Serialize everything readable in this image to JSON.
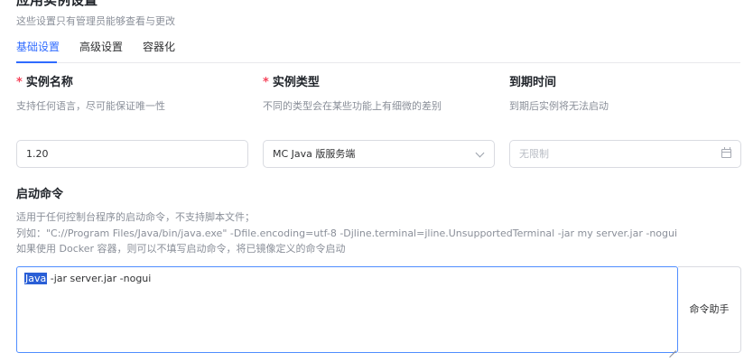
{
  "section": {
    "title": "应用实例设置",
    "description": "这些设置只有管理员能够查看与更改"
  },
  "tabs": [
    {
      "label": "基础设置",
      "active": true
    },
    {
      "label": "高级设置",
      "active": false
    },
    {
      "label": "容器化",
      "active": false
    }
  ],
  "fields": {
    "name": {
      "required_mark": "*",
      "title": "实例名称",
      "description": "支持任何语言，尽可能保证唯一性",
      "value": "1.20"
    },
    "type": {
      "required_mark": "*",
      "title": "实例类型",
      "description": "不同的类型会在某些功能上有细微的差别",
      "value": "MC Java 版服务端"
    },
    "expiry": {
      "title": "到期时间",
      "description": "到期后实例将无法启动",
      "placeholder": "无限制"
    }
  },
  "command": {
    "title": "启动命令",
    "description_lines": [
      "适用于任何控制台程序的启动命令，不支持脚本文件；",
      "列如：\"C://Program Files/Java/bin/java.exe\" -Dfile.encoding=utf-8 -Djline.terminal=jline.UnsupportedTerminal -jar my server.jar -nogui",
      "如果使用 Docker 容器，则可以不填写启动命令，将已镜像定义的命令启动"
    ],
    "value_selected": "Java",
    "value_rest": " -jar server.jar -nogui",
    "helper_button": "命令助手"
  },
  "colors": {
    "accent": "#2f6bff",
    "required": "#f5455c",
    "selection": "#2a5fd6"
  }
}
